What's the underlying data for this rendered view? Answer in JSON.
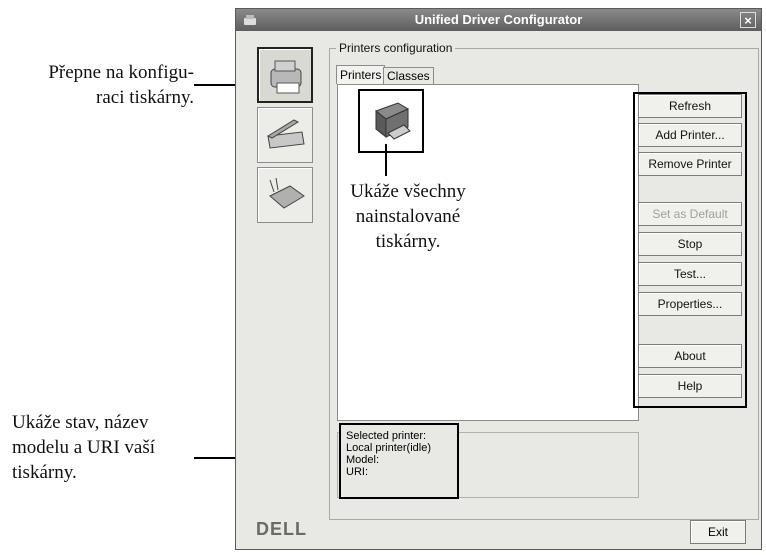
{
  "annotations": {
    "printer_config": [
      "Přepne na konfigu-",
      "raci tiskárny."
    ],
    "all_printers": [
      "Ukáže všechny",
      "nainstalované",
      "tiskárny."
    ],
    "status_info": [
      "Ukáže stav, název",
      "modelu a URI vaší",
      "tiskárny."
    ]
  },
  "window": {
    "title": "Unified Driver Configurator",
    "close_icon": "×"
  },
  "group_label": "Printers configuration",
  "tabs": [
    "Printers",
    "Classes"
  ],
  "buttons": {
    "refresh": "Refresh",
    "add_printer": "Add Printer...",
    "remove_printer": "Remove Printer",
    "set_default": "Set as Default",
    "stop": "Stop",
    "test": "Test...",
    "properties": "Properties...",
    "about": "About",
    "help": "Help",
    "exit": "Exit"
  },
  "status": {
    "selected": "Selected printer:",
    "printer": "Local printer(idle)",
    "model": "Model:",
    "uri": "URI:"
  },
  "logo": "DELL"
}
